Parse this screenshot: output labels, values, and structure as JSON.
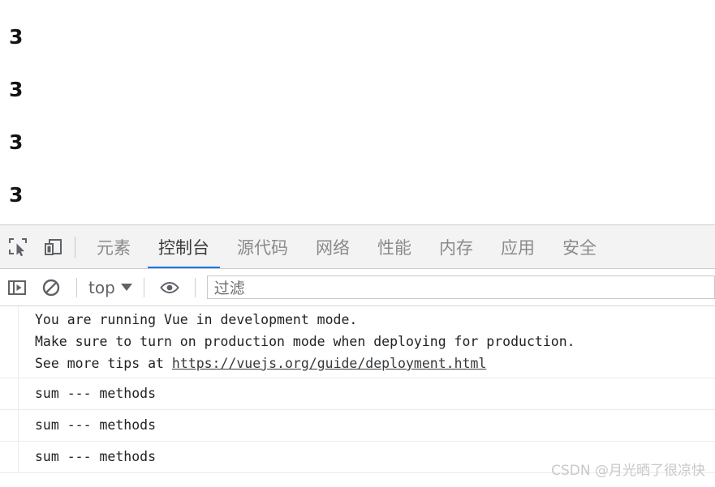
{
  "page": {
    "output_lines": [
      "3",
      "3",
      "3",
      "3"
    ]
  },
  "devtools": {
    "tabbar": {
      "inspect_icon": "inspect-element-icon",
      "device_icon": "device-toolbar-icon",
      "tabs": [
        {
          "label": "元素",
          "active": false
        },
        {
          "label": "控制台",
          "active": true
        },
        {
          "label": "源代码",
          "active": false
        },
        {
          "label": "网络",
          "active": false
        },
        {
          "label": "性能",
          "active": false
        },
        {
          "label": "内存",
          "active": false
        },
        {
          "label": "应用",
          "active": false
        },
        {
          "label": "安全",
          "active": false
        }
      ],
      "active_tab": "控制台",
      "active_underline_color": "#1a73e8"
    },
    "toolbar": {
      "sidebar_icon": "console-sidebar-icon",
      "clear_icon": "clear-console-icon",
      "context_label": "top",
      "context_caret": "chevron-down-icon",
      "eye_icon": "live-expression-eye-icon",
      "filter_placeholder": "过滤",
      "filter_value": ""
    },
    "console": {
      "messages": [
        {
          "type": "info",
          "lines": [
            {
              "text": "You are running Vue in development mode."
            },
            {
              "text": "Make sure to turn on production mode when deploying for production."
            },
            {
              "text": "See more tips at ",
              "link": "https://vuejs.org/guide/deployment.html"
            }
          ]
        },
        {
          "type": "log",
          "lines": [
            {
              "text": "sum --- methods"
            }
          ]
        },
        {
          "type": "log",
          "lines": [
            {
              "text": "sum --- methods"
            }
          ]
        },
        {
          "type": "log",
          "lines": [
            {
              "text": "sum --- methods"
            }
          ]
        }
      ]
    }
  },
  "watermark": {
    "text": "CSDN @月光晒了很凉快"
  }
}
